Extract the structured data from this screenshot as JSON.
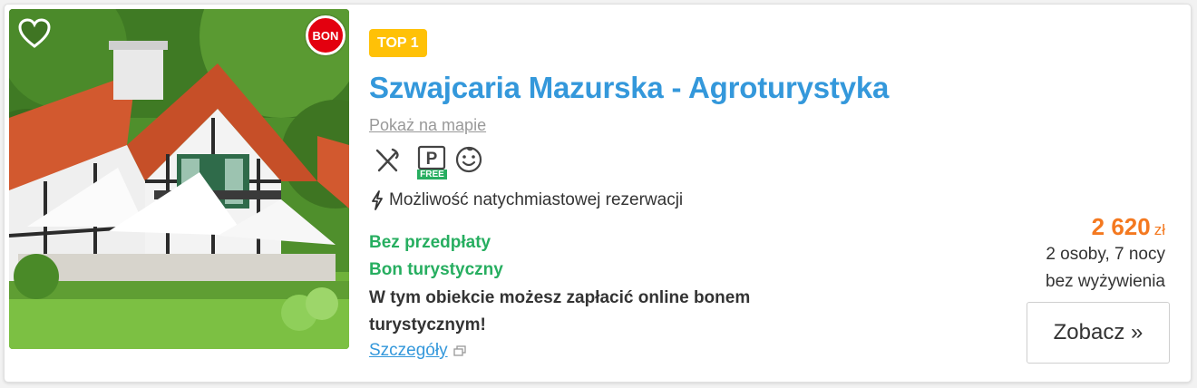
{
  "listing": {
    "badge": "TOP 1",
    "promo_badge": "BON",
    "title": "Szwajcaria Mazurska - Agroturystyka",
    "map_link": "Pokaż na mapie",
    "amenities": [
      {
        "icon": "restaurant-icon"
      },
      {
        "icon": "free-parking-icon",
        "label": "FREE"
      },
      {
        "icon": "child-friendly-icon"
      }
    ],
    "instant_booking": "Możliwość natychmiastowej rezerwacji",
    "no_prepayment": "Bez przedpłaty",
    "voucher": "Bon turystyczny",
    "voucher_description": "W tym obiekcie możesz zapłacić online bonem turystycznym!",
    "details_link": "Szczegóły",
    "price": "2 620",
    "currency": "zł",
    "price_info": "2 osoby, 7 nocy",
    "board": "bez wyżywienia",
    "cta": "Zobacz »"
  },
  "colors": {
    "title": "#3498db",
    "price": "#f47920",
    "green": "#27ae60",
    "badge": "#ffc107",
    "promo": "#e3000f"
  }
}
